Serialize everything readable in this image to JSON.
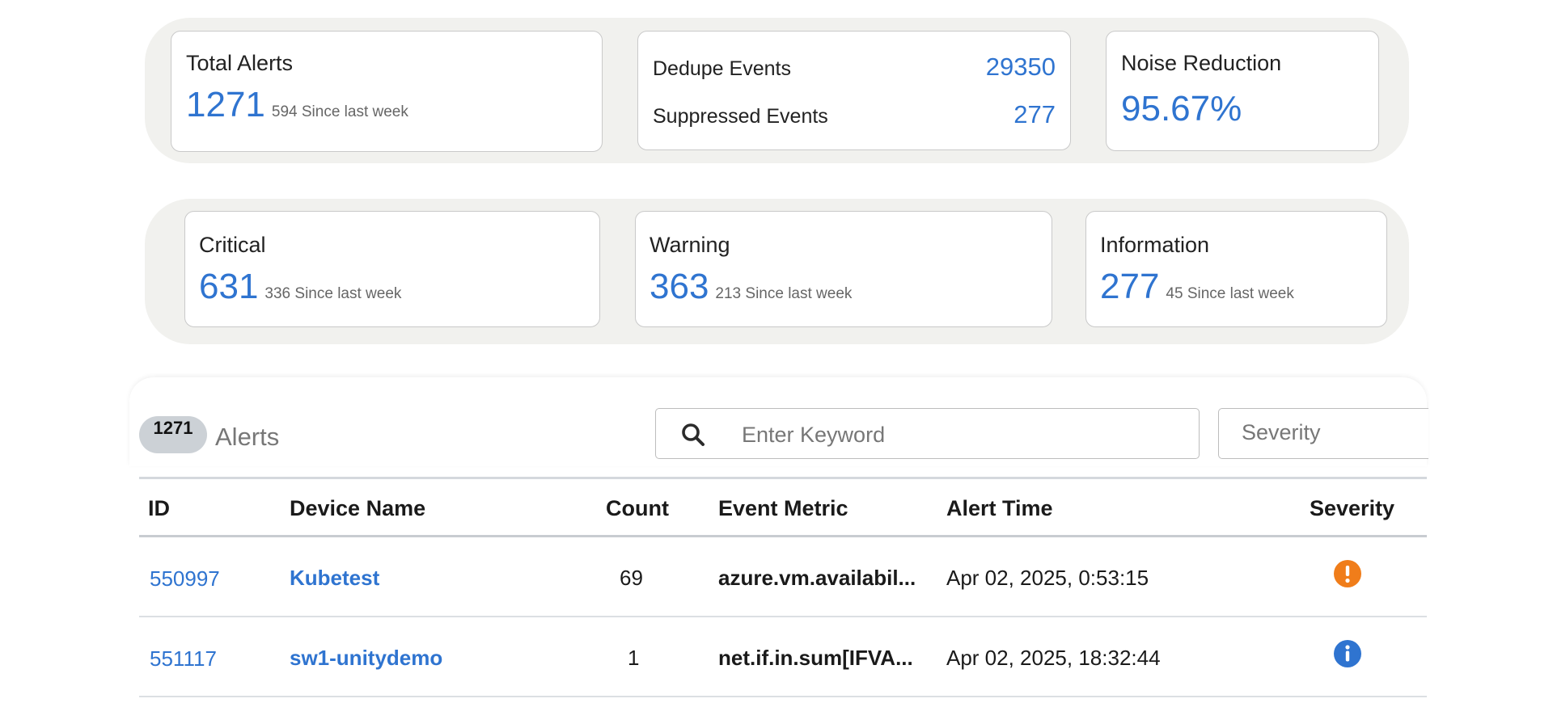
{
  "summary": {
    "total_alerts": {
      "title": "Total Alerts",
      "value": "1271",
      "since": "594 Since last week"
    },
    "dedupe": {
      "dedupe_label": "Dedupe Events",
      "dedupe_value": "29350",
      "suppressed_label": "Suppressed Events",
      "suppressed_value": "277"
    },
    "noise": {
      "title": "Noise Reduction",
      "value": "95.67%"
    }
  },
  "severity_cards": [
    {
      "title": "Critical",
      "value": "631",
      "since": "336 Since last week"
    },
    {
      "title": "Warning",
      "value": "363",
      "since": "213 Since last week"
    },
    {
      "title": "Information",
      "value": "277",
      "since": "45 Since last week"
    }
  ],
  "alerts": {
    "count": "1271",
    "label": "Alerts",
    "search_placeholder": "Enter Keyword",
    "severity_filter": "Severity",
    "columns": [
      "ID",
      "Device Name",
      "Count",
      "Event Metric",
      "Alert Time",
      "Severity"
    ],
    "rows": [
      {
        "id": "550997",
        "device": "Kubetest",
        "count": "69",
        "metric": "azure.vm.availabil...",
        "time": "Apr 02, 2025, 0:53:15",
        "severity": "critical"
      },
      {
        "id": "551117",
        "device": "sw1-unitydemo",
        "count": "1",
        "metric": "net.if.in.sum[IFVA...",
        "time": "Apr 02, 2025, 18:32:44",
        "severity": "information"
      }
    ]
  },
  "colors": {
    "accent": "#2f74d0",
    "critical": "#f07d1a",
    "information": "#2f74d0",
    "panel": "#f1f1ee"
  }
}
